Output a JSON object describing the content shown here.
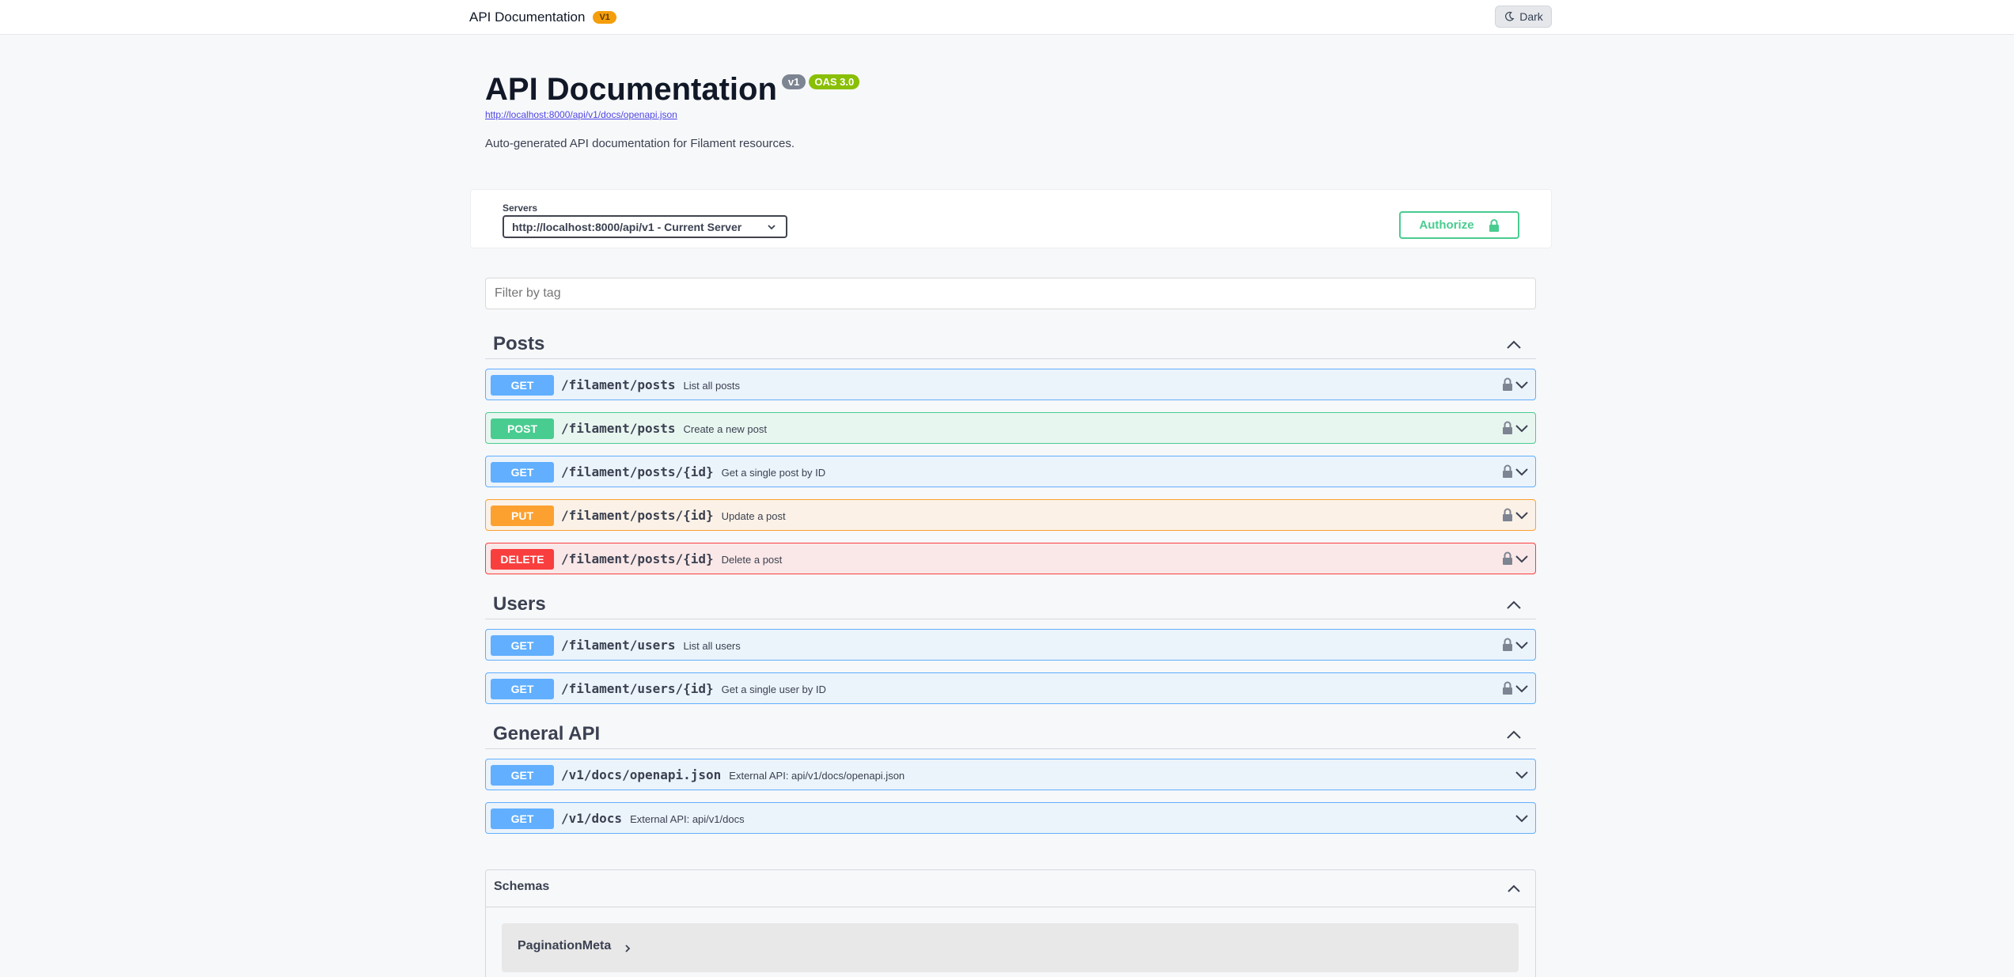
{
  "topbar": {
    "brand": "API Documentation",
    "version_badge": "V1",
    "dark_label": "Dark"
  },
  "info": {
    "title": "API Documentation",
    "version": "v1",
    "oas": "OAS 3.0",
    "spec_url": "http://localhost:8000/api/v1/docs/openapi.json",
    "description": "Auto-generated API documentation for Filament resources."
  },
  "servers": {
    "label": "Servers",
    "selected": "http://localhost:8000/api/v1 - Current Server",
    "authorize_label": "Authorize"
  },
  "filter": {
    "placeholder": "Filter by tag"
  },
  "tags": [
    {
      "name": "Posts",
      "operations": [
        {
          "method": "GET",
          "path": "/filament/posts",
          "summary": "List all posts"
        },
        {
          "method": "POST",
          "path": "/filament/posts",
          "summary": "Create a new post"
        },
        {
          "method": "GET",
          "path": "/filament/posts/{id}",
          "summary": "Get a single post by ID"
        },
        {
          "method": "PUT",
          "path": "/filament/posts/{id}",
          "summary": "Update a post"
        },
        {
          "method": "DELETE",
          "path": "/filament/posts/{id}",
          "summary": "Delete a post"
        }
      ]
    },
    {
      "name": "Users",
      "operations": [
        {
          "method": "GET",
          "path": "/filament/users",
          "summary": "List all users"
        },
        {
          "method": "GET",
          "path": "/filament/users/{id}",
          "summary": "Get a single user by ID"
        }
      ]
    },
    {
      "name": "General API",
      "operations": [
        {
          "method": "GET",
          "path": "/v1/docs/openapi.json",
          "summary": "External API: api/v1/docs/openapi.json"
        },
        {
          "method": "GET",
          "path": "/v1/docs",
          "summary": "External API: api/v1/docs"
        }
      ]
    }
  ],
  "schemas": {
    "title": "Schemas",
    "items": [
      "PaginationMeta"
    ]
  },
  "colors": {
    "get": "#61affe",
    "post": "#49cc90",
    "put": "#fca130",
    "delete": "#f93e3e"
  }
}
